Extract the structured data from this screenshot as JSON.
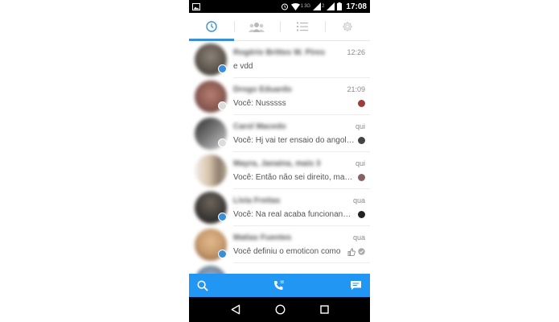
{
  "status_bar": {
    "time": "17:08",
    "sim1_label": "1",
    "sim2_label": "2",
    "network_label": "3G",
    "icons": [
      "image-icon",
      "alarm-icon",
      "wifi-icon",
      "signal-icon",
      "battery-icon"
    ]
  },
  "tabs": [
    {
      "name": "recent",
      "icon": "clock-icon",
      "active": true
    },
    {
      "name": "people",
      "icon": "people-icon",
      "active": false
    },
    {
      "name": "groups",
      "icon": "list-icon",
      "active": false
    },
    {
      "name": "settings",
      "icon": "gear-icon",
      "active": false
    }
  ],
  "conversations": [
    {
      "name": "Rogério Brittes W. Pires",
      "time": "12:26",
      "message": "e vdd",
      "avatar_color": "#6b6258",
      "badge": "blue",
      "seen": ""
    },
    {
      "name": "Drogo Eduardo",
      "time": "21:09",
      "message": "Você:  Nusssss",
      "avatar_color": "#8a5a52",
      "badge": "grey",
      "seen": "#9e3b3b"
    },
    {
      "name": "Carol Macedo",
      "time": "qui",
      "message": "Você: Hj vai ter ensaio do angola...",
      "avatar_color": "#5e5e5e",
      "badge": "grey",
      "seen": "#444444"
    },
    {
      "name": "Mayra, Janaina, mais 3",
      "time": "qui",
      "message": "Você: Então não sei direito, mas...",
      "avatar_color": "#b9a895",
      "badge": "",
      "seen": "#8a6060"
    },
    {
      "name": "Lívia Freitas",
      "time": "qua",
      "message": "Você: Na real acaba funcionando...",
      "avatar_color": "#3d3a37",
      "badge": "blue",
      "seen": "#222222"
    },
    {
      "name": "Matias Fuentes",
      "time": "qua",
      "message": "Você definiu o emoticon como",
      "avatar_color": "#c79a6e",
      "badge": "blue",
      "seen": "check"
    }
  ],
  "colors": {
    "accent": "#3a8fd8",
    "bottom_bar": "#2196f3"
  },
  "bottom_bar": {
    "icons": [
      "search-icon",
      "call-icon",
      "new-message-icon"
    ]
  },
  "nav_bar": {
    "icons": [
      "back-icon",
      "home-icon",
      "recents-icon"
    ]
  }
}
